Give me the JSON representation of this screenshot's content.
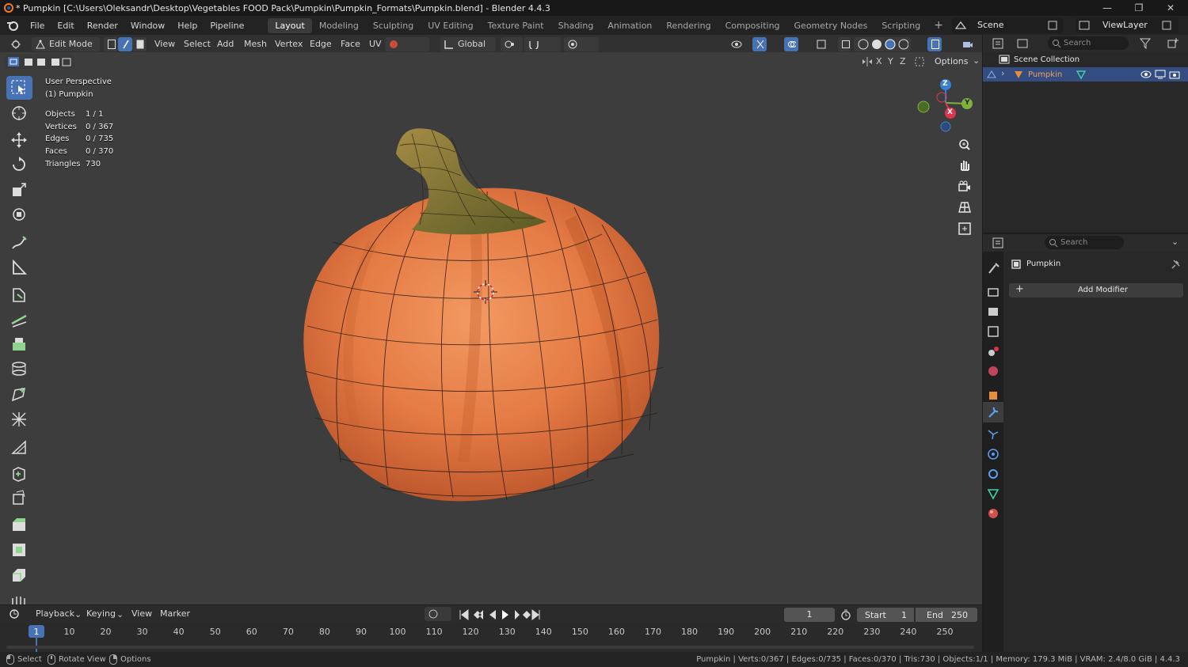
{
  "window": {
    "title": "* Pumpkin [C:\\Users\\Oleksandr\\Desktop\\Vegetables FOOD Pack\\Pumpkin\\Pumpkin_Formats\\Pumpkin.blend] - Blender 4.4.3",
    "minimize": "—",
    "maximize": "❐",
    "close": "✕"
  },
  "menu": {
    "items": [
      "File",
      "Edit",
      "Render",
      "Window",
      "Help",
      "Pipeline"
    ],
    "workspaces": [
      "Layout",
      "Modeling",
      "Sculpting",
      "UV Editing",
      "Texture Paint",
      "Shading",
      "Animation",
      "Rendering",
      "Compositing",
      "Geometry Nodes",
      "Scripting"
    ],
    "active_workspace": "Layout",
    "scene": "Scene",
    "view_layer": "ViewLayer"
  },
  "viewport_header": {
    "mode": "Edit Mode",
    "menus": [
      "View",
      "Select",
      "Add",
      "Mesh",
      "Vertex",
      "Edge",
      "Face",
      "UV"
    ],
    "orientation": "Global",
    "options": "Options",
    "axes": [
      "X",
      "Y",
      "Z"
    ]
  },
  "overlay_text": {
    "perspective": "User Perspective",
    "object": "(1) Pumpkin",
    "stats": [
      {
        "label": "Objects",
        "value": "1 / 1"
      },
      {
        "label": "Vertices",
        "value": "0 / 367"
      },
      {
        "label": "Edges",
        "value": "0 / 735"
      },
      {
        "label": "Faces",
        "value": "0 / 370"
      },
      {
        "label": "Triangles",
        "value": "730"
      }
    ]
  },
  "gizmo": {
    "z": "Z",
    "y": "Y",
    "x": "X"
  },
  "outliner": {
    "search_placeholder": "Search",
    "collection": "Scene Collection",
    "object": "Pumpkin"
  },
  "properties": {
    "search_placeholder": "Search",
    "object_name": "Pumpkin",
    "add_modifier": "Add Modifier"
  },
  "timeline": {
    "menus": [
      "Playback",
      "Keying",
      "View",
      "Marker"
    ],
    "current_frame": "1",
    "start_label": "Start",
    "start": "1",
    "end_label": "End",
    "end": "250",
    "ticks": [
      "1",
      "10",
      "20",
      "30",
      "40",
      "50",
      "60",
      "70",
      "80",
      "90",
      "100",
      "110",
      "120",
      "130",
      "140",
      "150",
      "160",
      "170",
      "180",
      "190",
      "200",
      "210",
      "220",
      "230",
      "240",
      "250"
    ]
  },
  "statusbar": {
    "hints": [
      "Select",
      "Rotate View",
      "Options"
    ],
    "info": "Pumpkin | Verts:0/367 | Edges:0/735 | Faces:0/370 | Tris:730 | Objects:1/1 | Memory: 179.3 MiB | VRAM: 2.4/8.0 GiB | 4.4.3"
  },
  "colors": {
    "accent": "#4772b3",
    "pumpkin": "#e0753f",
    "stem": "#6b6a2e",
    "viewport_bg": "#3d3d3d"
  }
}
